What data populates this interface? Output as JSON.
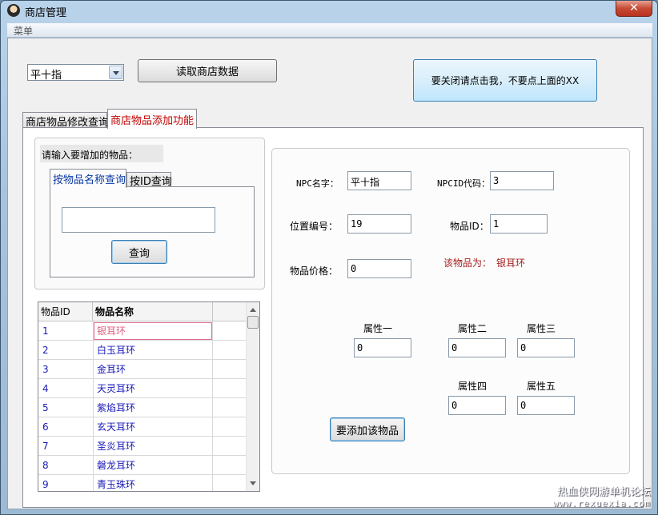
{
  "window": {
    "title": "商店管理",
    "close_glyph": "✕"
  },
  "menubar": {
    "menu_label": "菜单"
  },
  "top": {
    "npc_select_value": "平十指",
    "load_button": "读取商店数据",
    "close_hint_button": "要关闭请点击我，不要点上面的XX"
  },
  "main_tabs": [
    {
      "label": "商店物品修改查询"
    },
    {
      "label": "商店物品添加功能"
    }
  ],
  "search_group": {
    "prompt": "请输入要增加的物品：",
    "tabs": [
      {
        "label": "按物品名称查询"
      },
      {
        "label": "按ID查询"
      }
    ],
    "input_value": "",
    "query_button": "查询"
  },
  "grid": {
    "columns": [
      "物品ID",
      "物品名称"
    ],
    "rows": [
      {
        "id": "1",
        "name": "银耳环"
      },
      {
        "id": "2",
        "name": "白玉耳环"
      },
      {
        "id": "3",
        "name": "金耳环"
      },
      {
        "id": "4",
        "name": "天灵耳环"
      },
      {
        "id": "5",
        "name": "紫焰耳环"
      },
      {
        "id": "6",
        "name": "玄天耳环"
      },
      {
        "id": "7",
        "name": "圣炎耳环"
      },
      {
        "id": "8",
        "name": "磐龙耳环"
      },
      {
        "id": "9",
        "name": "青玉珠环"
      }
    ],
    "selected_row": 0
  },
  "form": {
    "npc_name_label": "NPC名字：",
    "npc_name_value": "平十指",
    "npc_id_label": "NPCID代码：",
    "npc_id_value": "3",
    "pos_label": "位置编号：",
    "pos_value": "19",
    "item_id_label": "物品ID：",
    "item_id_value": "1",
    "price_label": "物品价格：",
    "price_value": "0",
    "item_is_label": "该物品为：",
    "item_is_value": "银耳环",
    "attr1_label": "属性一",
    "attr1_value": "0",
    "attr2_label": "属性二",
    "attr2_value": "0",
    "attr3_label": "属性三",
    "attr3_value": "0",
    "attr4_label": "属性四",
    "attr4_value": "0",
    "attr5_label": "属性五",
    "attr5_value": "0",
    "add_button": "要添加该物品"
  },
  "watermark": {
    "line1": "热血侠网游单机论坛",
    "line2": "www.rexuexia.com"
  }
}
